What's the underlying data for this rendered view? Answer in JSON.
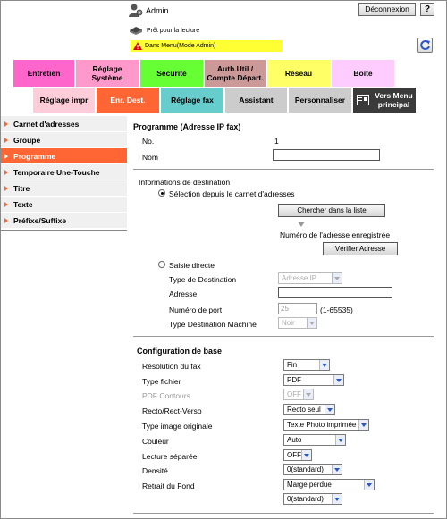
{
  "header": {
    "user_label": "Admin.",
    "logout_label": "Déconnexion",
    "help_label": "?",
    "status_label": "Prêt pour la lecture",
    "mode_label": "Dans Menu(Mode Admin)"
  },
  "tabs_row1": [
    {
      "label": "Entretien",
      "color": "#ff66cc"
    },
    {
      "label": "Réglage Système",
      "color": "#ff99cc"
    },
    {
      "label": "Sécurité",
      "color": "#66ff33"
    },
    {
      "label": "Auth.Util / Compte Départ.",
      "color": "#cc9999"
    },
    {
      "label": "Réseau",
      "color": "#ffff66"
    },
    {
      "label": "Boîte",
      "color": "#ffccff"
    }
  ],
  "tabs_row2": [
    {
      "label": "Réglage impr",
      "color": "#ffccd9"
    },
    {
      "label": "Enr. Dest.",
      "color": "#ff6633"
    },
    {
      "label": "Réglage fax",
      "color": "#66cccc"
    },
    {
      "label": "Assistant",
      "color": "#cccccc"
    },
    {
      "label": "Personnaliser",
      "color": "#cccccc"
    },
    {
      "label": "Vers Menu principal",
      "color": "#3a3a3a"
    }
  ],
  "sidebar": {
    "items": [
      {
        "label": "Carnet d'adresses",
        "active": false
      },
      {
        "label": "Groupe",
        "active": false
      },
      {
        "label": "Programme",
        "active": true
      },
      {
        "label": "Temporaire Une-Touche",
        "active": false
      },
      {
        "label": "Titre",
        "active": false
      },
      {
        "label": "Texte",
        "active": false
      },
      {
        "label": "Préfixe/Suffixe",
        "active": false
      }
    ]
  },
  "main": {
    "title": "Programme (Adresse IP fax)",
    "no_label": "No.",
    "no_value": "1",
    "nom_label": "Nom",
    "nom_value": "",
    "dest_info_label": "Informations de destination",
    "radio_addressbook_label": "Sélection depuis le carnet d'adresses",
    "search_list_button": "Chercher dans la liste",
    "registered_number_label": "Numéro de l'adresse enregistrée",
    "verify_address_button": "Vérifier Adresse",
    "radio_direct_label": "Saisie directe",
    "dest_type_label": "Type de Destination",
    "dest_type_value": "Adresse IP",
    "address_label": "Adresse",
    "address_value": "",
    "port_label": "Numéro de port",
    "port_value": "25",
    "port_range": "(1-65535)",
    "machine_type_label": "Type Destination Machine",
    "machine_type_value": "Noir"
  },
  "config": {
    "title": "Configuration de base",
    "rows": [
      {
        "label": "Résolution du fax",
        "value": "Fin",
        "disabled": false
      },
      {
        "label": "Type fichier",
        "value": "PDF",
        "disabled": false
      },
      {
        "label": "PDF Contours",
        "value": "OFF",
        "disabled": true
      },
      {
        "label": "Recto/Rect-Verso",
        "value": "Recto seul",
        "disabled": false
      },
      {
        "label": "Type image originale",
        "value": "Texte Photo imprimée",
        "disabled": false
      },
      {
        "label": "Couleur",
        "value": "Auto",
        "disabled": false
      },
      {
        "label": "Lecture séparée",
        "value": "OFF",
        "disabled": false
      },
      {
        "label": "Densité",
        "value": "0(standard)",
        "disabled": false
      },
      {
        "label": "Retrait du Fond",
        "value": "Marge perdue",
        "disabled": false
      },
      {
        "label": "",
        "value": "0(standard)",
        "disabled": false
      }
    ]
  },
  "colors": {
    "accent": "#ff6633",
    "mode_bar": "#ffff33"
  }
}
